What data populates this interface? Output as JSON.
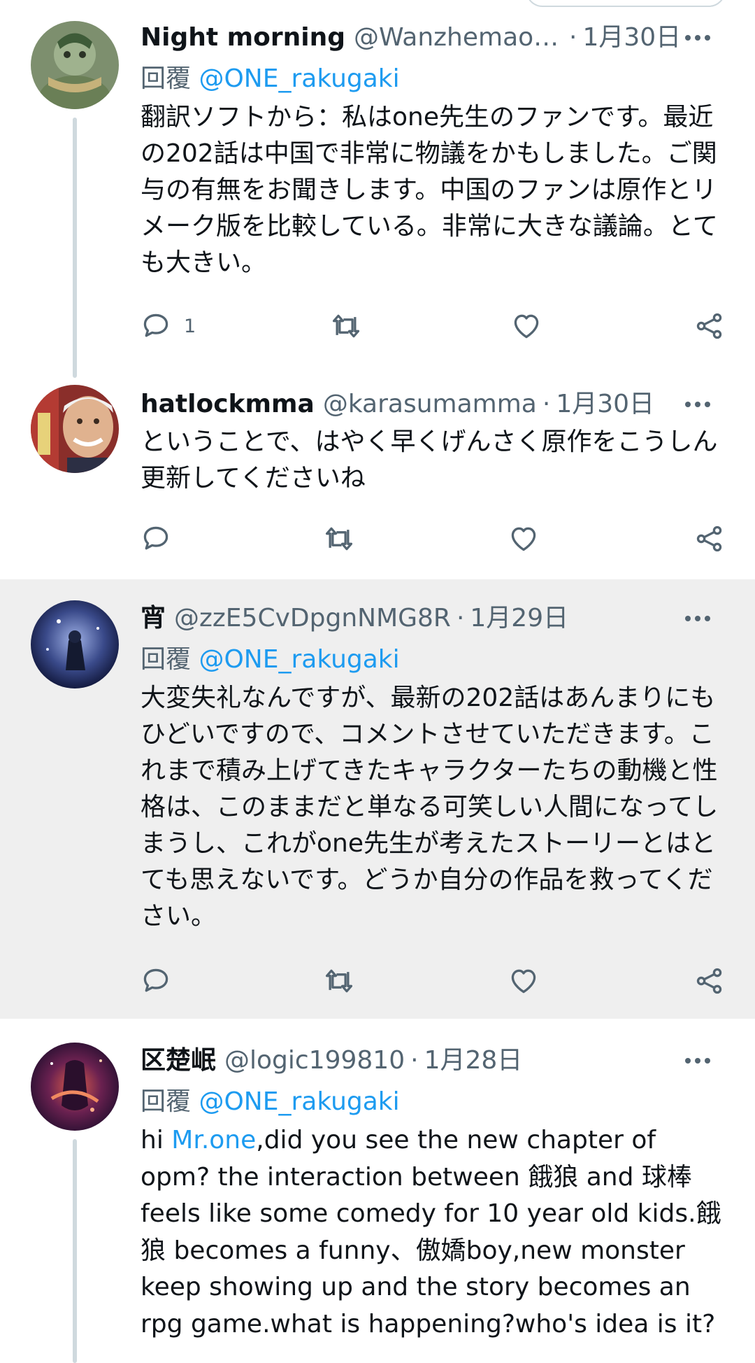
{
  "tweets": [
    {
      "name": "Night morning",
      "handle": "@Wanzhemaos...",
      "separator": "·",
      "time": "1月30日",
      "reply_prefix": "回覆",
      "reply_to": "@ONE_rakugaki",
      "text": "翻訳ソフトから：私はone先生のファンです。最近の202話は中国で非常に物議をかもしました。ご関与の有無をお聞きします。中国のファンは原作とリメーク版を比較している。非常に大きな議論。とても大きい。",
      "reply_count": "1"
    },
    {
      "name": "hatlockmma",
      "handle": "@karasumamma",
      "separator": "·",
      "time": "1月30日",
      "text": "ということで、はやく早くげんさく原作をこうしん更新してくださいね"
    },
    {
      "name": "宵",
      "handle": "@zzE5CvDpgnNMG8R",
      "separator": "·",
      "time": "1月29日",
      "reply_prefix": "回覆",
      "reply_to": "@ONE_rakugaki",
      "text": "大変失礼なんですが、最新の202話はあんまりにもひどいですので、コメントさせていただきます。これまで積み上げてきたキャラクターたちの動機と性格は、このままだと単なる可笑しい人間になってしまうし、これがone先生が考えたストーリーとはとても思えないです。どうか自分の作品を救ってください。"
    },
    {
      "name": "区楚岷",
      "handle": "@logic199810",
      "separator": "·",
      "time": "1月28日",
      "reply_prefix": "回覆",
      "reply_to": "@ONE_rakugaki",
      "text_pre": "hi ",
      "text_link": "Mr.one",
      "text_post": ",did you see the new chapter of opm? the interaction between 餓狼 and 球棒feels like some comedy for 10 year old kids.餓狼 becomes a funny、傲嬌boy,new monster keep showing up and the story becomes an rpg game.what is happening?who's idea is it?"
    }
  ],
  "icons": {
    "more": "more-horizontal-icon",
    "reply": "reply-bubble-icon",
    "retweet": "retweet-icon",
    "like": "heart-icon",
    "share": "share-icon"
  },
  "colors": {
    "link": "#1d9bf0",
    "secondary_text": "#536471",
    "highlight_bg": "#efefef",
    "thread_line": "#cfd9de"
  }
}
